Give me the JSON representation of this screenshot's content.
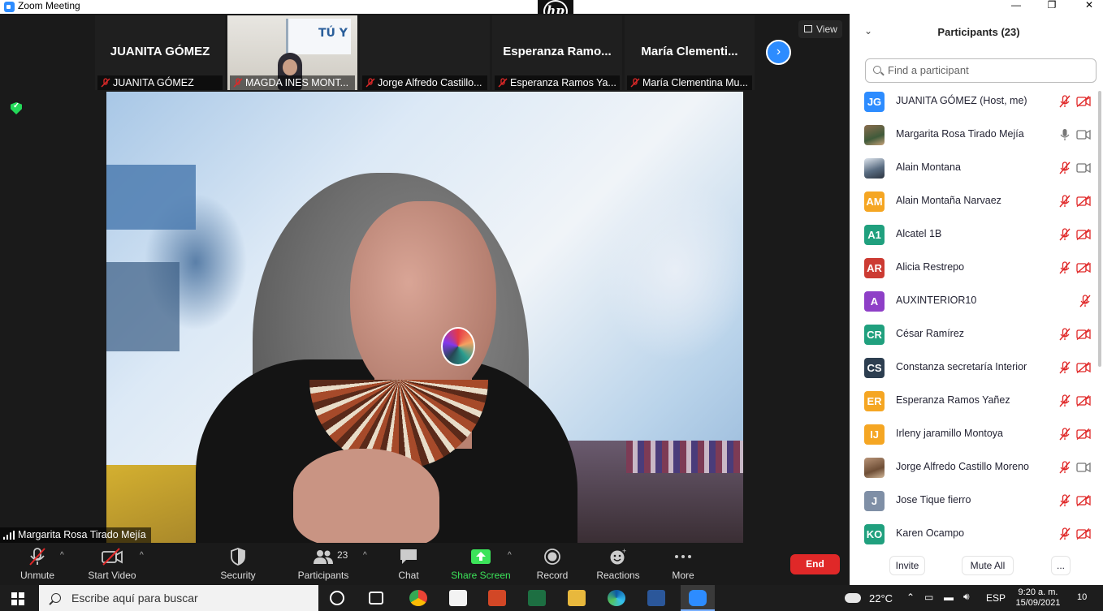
{
  "window": {
    "title": "Zoom Meeting",
    "minimize": "—",
    "maximize": "❐",
    "close": "✕"
  },
  "strip": {
    "tiles": [
      {
        "big_name": "JUANITA GÓMEZ",
        "label": "JUANITA GÓMEZ"
      },
      {
        "big_name": "",
        "label": "MAGDA INES MONT...",
        "poster_text": "TÚ Y"
      },
      {
        "big_name": "",
        "label": "Jorge Alfredo Castillo..."
      },
      {
        "big_name": "Esperanza  Ramo...",
        "label": "Esperanza Ramos Ya..."
      },
      {
        "big_name": "María  Clementi...",
        "label": "María Clementina Mu..."
      }
    ],
    "next_glyph": "›"
  },
  "view_label": "View",
  "active_speaker": "Margarita Rosa Tirado Mejía",
  "toolbar": {
    "unmute": "Unmute",
    "start_video": "Start Video",
    "security": "Security",
    "participants": "Participants",
    "participant_count": "23",
    "chat": "Chat",
    "share_screen": "Share Screen",
    "record": "Record",
    "reactions": "Reactions",
    "more": "More",
    "end": "End",
    "caret": "^"
  },
  "panel": {
    "title": "Participants (23)",
    "collapse_glyph": "⌄",
    "search_placeholder": "Find a participant",
    "participants": [
      {
        "initials": "JG",
        "color": "#2d8cff",
        "name": "JUANITA GÓMEZ (Host, me)",
        "mic": "muted",
        "cam": "off",
        "avatar": "initials"
      },
      {
        "initials": "",
        "color": "#8a6d4e",
        "name": "Margarita Rosa Tirado Mejía",
        "mic": "on",
        "cam": "on",
        "avatar": "photo"
      },
      {
        "initials": "",
        "color": "#5a6d82",
        "name": "Alain Montana",
        "mic": "muted",
        "cam": "on",
        "avatar": "photo2"
      },
      {
        "initials": "AM",
        "color": "#f5a623",
        "name": "Alain Montaña Narvaez",
        "mic": "muted",
        "cam": "off",
        "avatar": "initials"
      },
      {
        "initials": "A1",
        "color": "#20a07e",
        "name": "Alcatel 1B",
        "mic": "muted",
        "cam": "off",
        "avatar": "initials"
      },
      {
        "initials": "AR",
        "color": "#cc3b33",
        "name": "Alicia Restrepo",
        "mic": "muted",
        "cam": "off",
        "avatar": "initials"
      },
      {
        "initials": "A",
        "color": "#8e3fc7",
        "name": "AUXINTERIOR10",
        "mic": "muted",
        "cam": "none",
        "avatar": "initials"
      },
      {
        "initials": "CR",
        "color": "#20a07e",
        "name": "César Ramírez",
        "mic": "muted",
        "cam": "off",
        "avatar": "initials"
      },
      {
        "initials": "CS",
        "color": "#2d3e50",
        "name": "Constanza secretaría Interior",
        "mic": "muted",
        "cam": "off",
        "avatar": "initials"
      },
      {
        "initials": "ER",
        "color": "#f5a623",
        "name": "Esperanza Ramos Yañez",
        "mic": "muted",
        "cam": "off",
        "avatar": "initials"
      },
      {
        "initials": "IJ",
        "color": "#f5a623",
        "name": "Irleny jaramillo Montoya",
        "mic": "muted",
        "cam": "off",
        "avatar": "initials"
      },
      {
        "initials": "",
        "color": "#b89478",
        "name": "Jorge Alfredo Castillo Moreno",
        "mic": "muted",
        "cam": "on",
        "avatar": "photo3"
      },
      {
        "initials": "J",
        "color": "#7f8fa6",
        "name": "Jose Tique fierro",
        "mic": "muted",
        "cam": "off",
        "avatar": "initials"
      },
      {
        "initials": "KO",
        "color": "#20a07e",
        "name": "Karen Ocampo",
        "mic": "muted",
        "cam": "off",
        "avatar": "initials"
      }
    ],
    "invite": "Invite",
    "mute_all": "Mute All",
    "more": "..."
  },
  "taskbar": {
    "search_placeholder": "Escribe aquí para buscar",
    "temperature": "22°C",
    "language": "ESP",
    "time": "9:20 a. m.",
    "date": "15/09/2021",
    "notifications": "10"
  },
  "colors": {
    "accent": "#2d8cff",
    "end": "#e02828",
    "share": "#3ce35a",
    "muted_red": "#e02828"
  }
}
